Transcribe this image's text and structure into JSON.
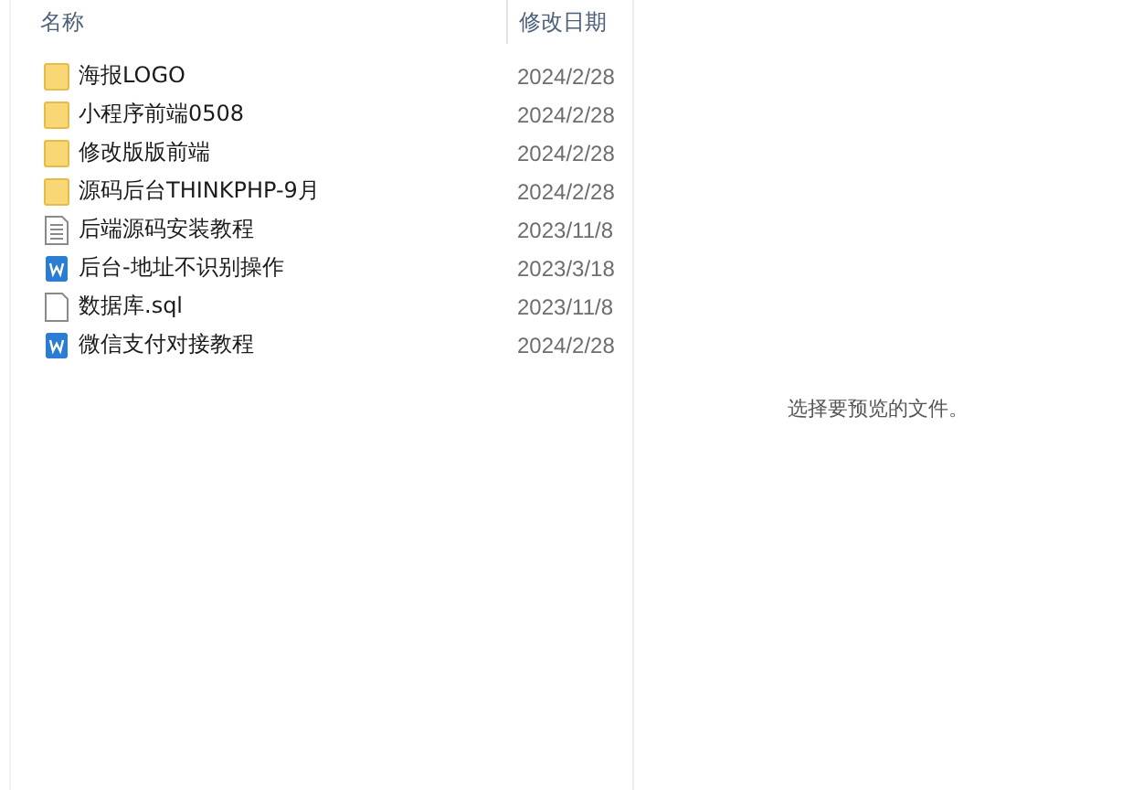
{
  "columns": [
    "名称",
    "修改日期"
  ],
  "files": [
    {
      "kind": "folder",
      "name": "海报LOGO",
      "date": "2024/2/28"
    },
    {
      "kind": "folder",
      "name": "小程序前端0508",
      "date": "2024/2/28"
    },
    {
      "kind": "folder",
      "name": "修改版版前端",
      "date": "2024/2/28"
    },
    {
      "kind": "folder",
      "name": "源码后台THINKPHP-9月",
      "date": "2024/2/28"
    },
    {
      "kind": "text",
      "name": "后端源码安装教程",
      "date": "2023/11/8"
    },
    {
      "kind": "word",
      "name": "后台-地址不识别操作",
      "date": "2023/3/18"
    },
    {
      "kind": "blank",
      "name": "数据库.sql",
      "date": "2023/11/8"
    },
    {
      "kind": "word",
      "name": "微信支付对接教程",
      "date": "2024/2/28"
    }
  ],
  "preview": {
    "message": "选择要预览的文件。"
  }
}
